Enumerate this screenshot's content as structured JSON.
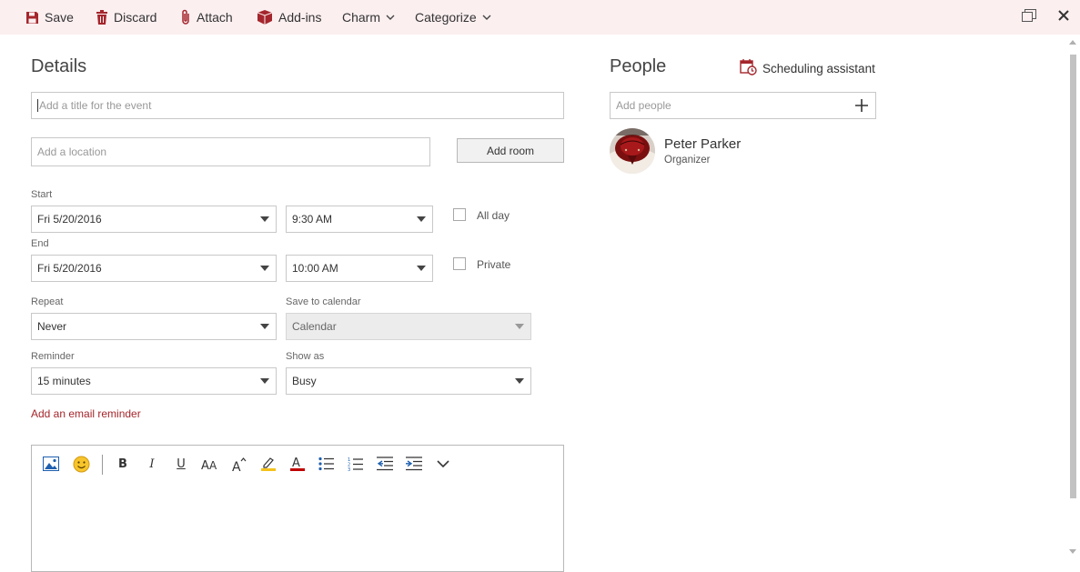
{
  "toolbar": {
    "save": "Save",
    "discard": "Discard",
    "attach": "Attach",
    "addins": "Add-ins",
    "charm": "Charm",
    "categorize": "Categorize"
  },
  "details": {
    "heading": "Details",
    "title_placeholder": "Add a title for the event",
    "location_placeholder": "Add a location",
    "add_room": "Add room",
    "start_label": "Start",
    "start_date": "Fri 5/20/2016",
    "start_time": "9:30 AM",
    "all_day": "All day",
    "end_label": "End",
    "end_date": "Fri 5/20/2016",
    "end_time": "10:00 AM",
    "private": "Private",
    "repeat_label": "Repeat",
    "repeat_value": "Never",
    "save_to_label": "Save to calendar",
    "save_to_value": "Calendar",
    "reminder_label": "Reminder",
    "reminder_value": "15 minutes",
    "show_as_label": "Show as",
    "show_as_value": "Busy",
    "email_reminder": "Add an email reminder"
  },
  "people": {
    "heading": "People",
    "scheduling": "Scheduling assistant",
    "add_placeholder": "Add people",
    "attendees": [
      {
        "name": "Peter Parker",
        "role": "Organizer"
      }
    ]
  },
  "colors": {
    "accent": "#a4262c",
    "toolbar_bg": "#fbeff0"
  },
  "editor_tools": [
    "insert-picture-icon",
    "emoji-icon",
    "bold-icon",
    "italic-icon",
    "underline-icon",
    "font-size-icon",
    "grow-font-icon",
    "highlight-icon",
    "font-color-icon",
    "bullets-icon",
    "numbering-icon",
    "decrease-indent-icon",
    "increase-indent-icon",
    "more-icon"
  ]
}
